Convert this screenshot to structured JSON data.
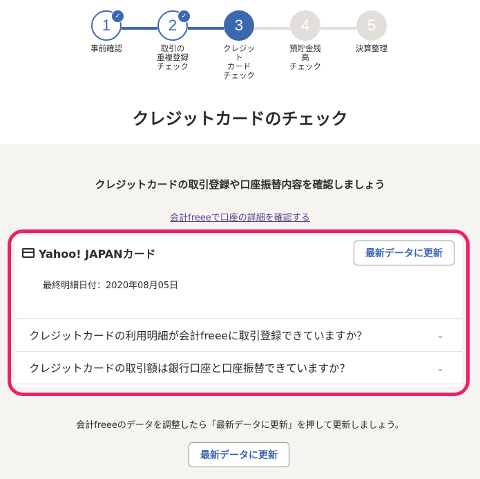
{
  "steps": [
    {
      "num": "1",
      "label": "事前確認",
      "state": "done"
    },
    {
      "num": "2",
      "label": "取引の\n重複登録\nチェック",
      "state": "done"
    },
    {
      "num": "3",
      "label": "クレジッ\nト\nカード\nチェック",
      "state": "current"
    },
    {
      "num": "4",
      "label": "預貯金残\n高\nチェック",
      "state": "todo"
    },
    {
      "num": "5",
      "label": "決算整理",
      "state": "todo"
    }
  ],
  "check_mark": "✓",
  "page_title": "クレジットカードのチェック",
  "subtitle": "クレジットカードの取引登録や口座振替内容を確認しましょう",
  "account_link": "会計freeeで口座の詳細を確認する",
  "card": {
    "name": "Yahoo! JAPANカード",
    "refresh_label": "最新データに更新",
    "last_statement": "最終明細日付：2020年08月05日",
    "questions": [
      "クレジットカードの利用明細が会計freeeに取引登録できていますか？",
      "クレジットカードの取引額は銀行口座と口座振替できていますか？"
    ]
  },
  "chevron": "⌄",
  "footer_note": "会計freeeのデータを調整したら「最新データに更新」を押して更新しましょう。",
  "footer_button": "最新データに更新",
  "colors": {
    "accent": "#3c68b0",
    "highlight": "#ee1f6a",
    "todo": "#e2dfdb"
  }
}
